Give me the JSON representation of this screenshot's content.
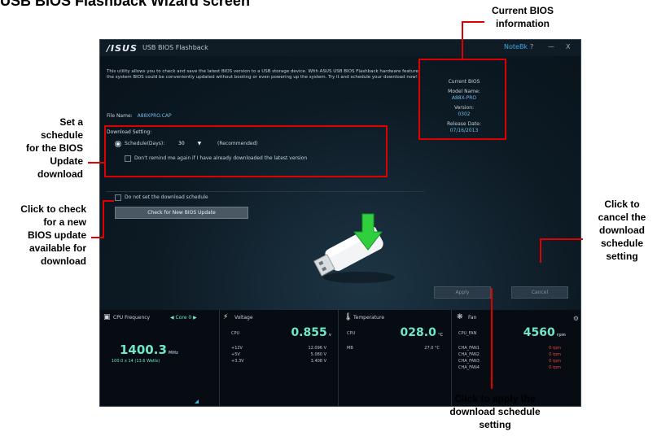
{
  "heading": "USB BIOS Flashback Wizard screen",
  "callouts": {
    "current_bios": "Current BIOS\ninformation",
    "set_schedule": "Set a\nschedule\nfor the BIOS\nUpdate\ndownload",
    "check_update": "Click to check\nfor a new\nBIOS update\navailable for\ndownload",
    "cancel": "Click to\ncancel the\ndownload\nschedule\nsetting",
    "apply": "Click to apply the\ndownload schedule\nsetting"
  },
  "window": {
    "logo": "/ISUS",
    "title": "USB BIOS Flashback",
    "controls": [
      "NoteBk",
      "?",
      "—",
      "X"
    ],
    "description": "This utility allows you to check and save the latest BIOS version to a USB storage device. With ASUS USB BIOS Flashback hardware feature, the system BIOS could be conveniently updated without booting or even powering up the system. Try it and schedule your download now!",
    "file_name_label": "File Name:",
    "file_name": "A88XPRO.CAP",
    "download_setting_title": "Download Setting:",
    "schedule_label": "Schedule(Days):",
    "schedule_value": "30",
    "schedule_note": "(Recommended)",
    "dont_remind": "Don't remind me again if I have already downloaded the latest version",
    "do_not_set": "Do not set the download schedule",
    "check_button": "Check for New BIOS Update",
    "current_bios": {
      "title": "Current BIOS",
      "model_label": "Model Name:",
      "model": "A88X-PRO",
      "version_label": "Version:",
      "version": "0302",
      "date_label": "Release Date:",
      "date": "07/16/2013"
    },
    "apply_button": "Apply",
    "cancel_button": "Cancel"
  },
  "monitor": {
    "cpu_freq": {
      "title": "CPU Frequency",
      "core": "Core 0",
      "value": "1400.3",
      "unit": "MHz",
      "sub": "100.0 x 14 (13.6 Watts)"
    },
    "voltage": {
      "title": "Voltage",
      "cpu_label": "CPU",
      "value": "0.855",
      "unit": "v",
      "rows": [
        {
          "label": "+12V",
          "value": "12.096 V"
        },
        {
          "label": "+5V",
          "value": "5.080 V"
        },
        {
          "label": "+3.3V",
          "value": "3.408 V"
        }
      ]
    },
    "temperature": {
      "title": "Temperature",
      "cpu_label": "CPU",
      "value": "028.0",
      "unit": "°C",
      "rows": [
        {
          "label": "MB",
          "value": "27.0 °C"
        }
      ]
    },
    "fan": {
      "title": "Fan",
      "cpu_label": "CPU_FAN",
      "value": "4560",
      "unit": "rpm",
      "rows": [
        {
          "label": "CHA_FAN1",
          "value": "0 rpm"
        },
        {
          "label": "CHA_FAN2",
          "value": "0 rpm"
        },
        {
          "label": "CHA_FAN3",
          "value": "0 rpm"
        },
        {
          "label": "CHA_FAN4",
          "value": "0 rpm"
        }
      ]
    }
  }
}
